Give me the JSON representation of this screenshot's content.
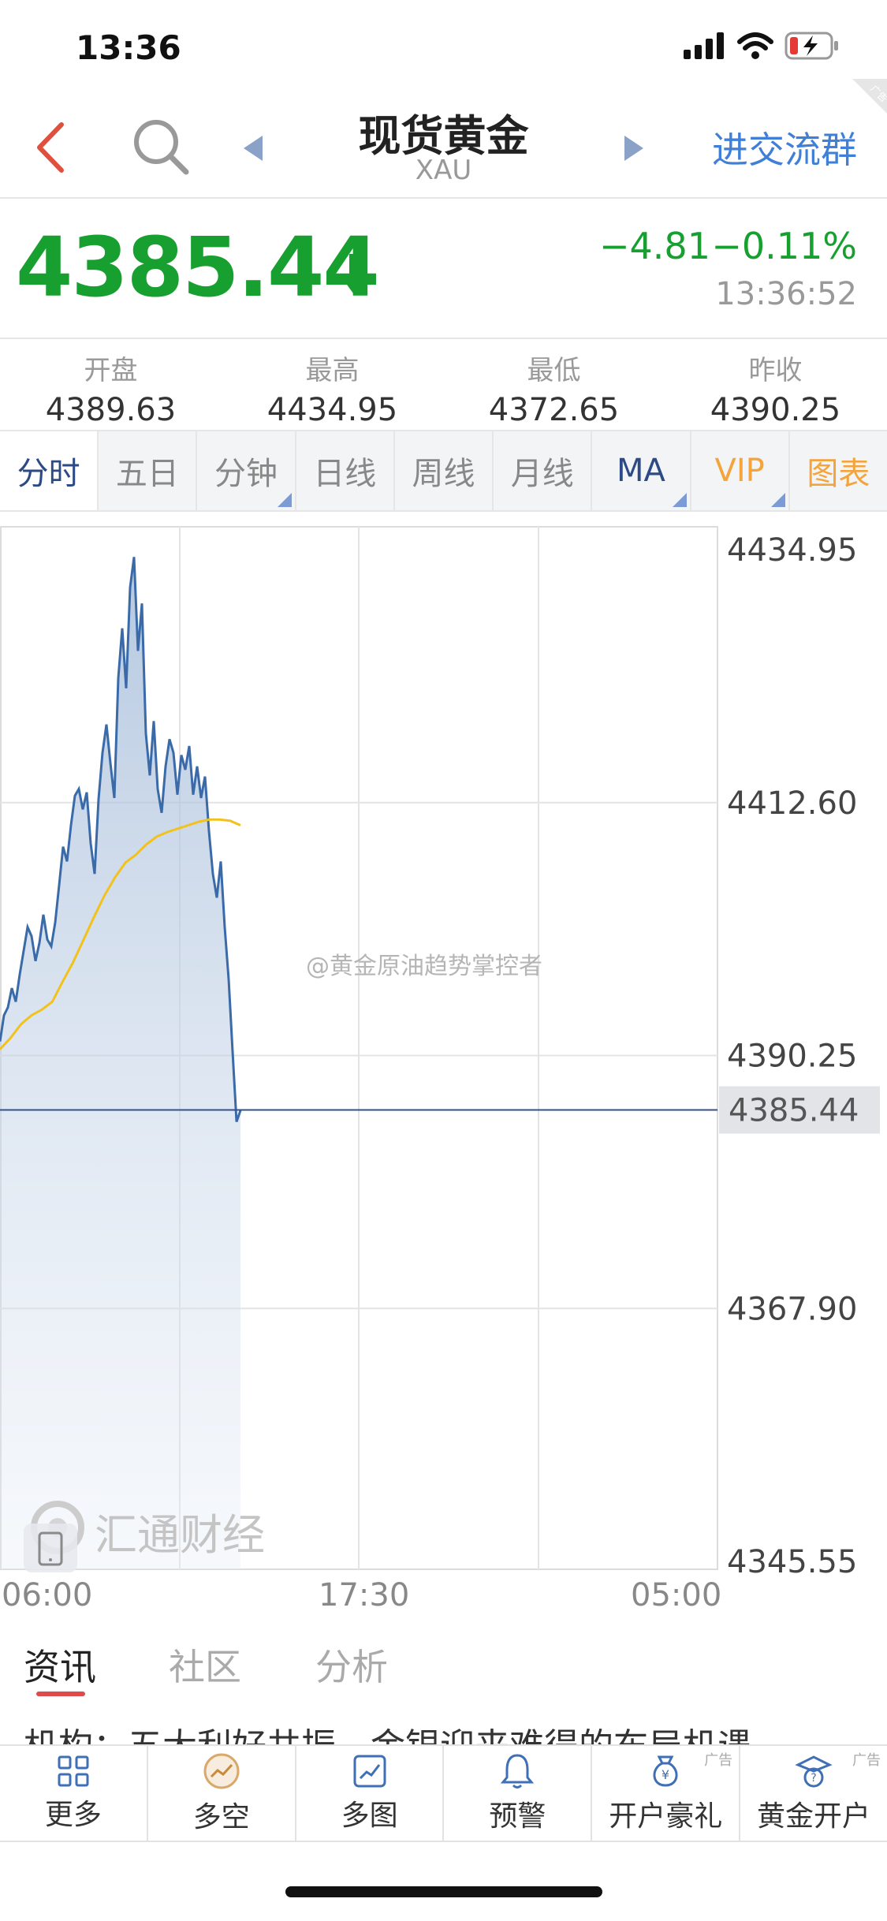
{
  "status": {
    "time": "13:36"
  },
  "header": {
    "title": "现货黄金",
    "subtitle": "XAU",
    "group_link": "进交流群",
    "ad_tag": "广告"
  },
  "quote": {
    "price": "4385.44",
    "change": "−4.81",
    "change_pct": "−0.11%",
    "time": "13:36:52",
    "color_down": "#17a02f"
  },
  "stats": [
    {
      "label": "开盘",
      "value": "4389.63"
    },
    {
      "label": "最高",
      "value": "4434.95"
    },
    {
      "label": "最低",
      "value": "4372.65"
    },
    {
      "label": "昨收",
      "value": "4390.25"
    }
  ],
  "tabs": [
    "分时",
    "五日",
    "分钟",
    "日线",
    "周线",
    "月线",
    "MA",
    "VIP",
    "图表"
  ],
  "chart_data": {
    "type": "area",
    "y_ticks": [
      "4434.95",
      "4412.60",
      "4390.25",
      "4367.90",
      "4345.55"
    ],
    "ylim": [
      4345.55,
      4434.95
    ],
    "x_ticks": [
      "06:00",
      "17:30",
      "05:00"
    ],
    "current_price_label": "4385.44",
    "current_price": 4385.44,
    "reference_price": 4390.25,
    "series": [
      {
        "values": [
          4391.5,
          4393.8,
          4394.5,
          4396.2,
          4395.0,
          4397.4,
          4399.5,
          4401.6,
          4400.8,
          4398.6,
          4400.2,
          4402.7,
          4400.5,
          4399.9,
          4402.0,
          4405.3,
          4408.7,
          4407.4,
          4410.6,
          4413.2,
          4413.8,
          4412.0,
          4413.5,
          4409.0,
          4406.3,
          4412.9,
          4417.0,
          4419.5,
          4416.1,
          4413.0,
          4423.6,
          4428.0,
          4422.7,
          4431.6,
          4434.3,
          4426.0,
          4430.2,
          4418.7,
          4415.0,
          4419.8,
          4413.8,
          4411.7,
          4415.8,
          4418.2,
          4417.0,
          4413.3,
          4416.8,
          4415.5,
          4417.6,
          4413.3,
          4415.8,
          4413.0,
          4414.9,
          4410.1,
          4406.3,
          4404.2,
          4407.4,
          4401.6,
          4397.0,
          4390.6,
          4384.4,
          4385.4
        ]
      },
      {
        "values": [
          4390.8,
          4391.8,
          4393.0,
          4393.8,
          4394.3,
          4395.0,
          4396.8,
          4398.5,
          4400.5,
          4402.5,
          4404.4,
          4406.0,
          4407.3,
          4408.0,
          4408.9,
          4409.6,
          4410.0,
          4410.3,
          4410.6,
          4410.9,
          4411.1,
          4411.1,
          4411.0,
          4410.6
        ]
      }
    ],
    "colors": {
      "price_line": "#3a6aa8",
      "average_line": "#f2c21b"
    }
  },
  "watermarks": {
    "weibo": "@黄金原油趋势掌控者",
    "brand": "汇通财经"
  },
  "subtabs": [
    "资讯",
    "社区",
    "分析"
  ],
  "news_headline": "机构：五大利好共振，金银迎来难得的布局机遇",
  "bottom_bar": [
    {
      "label": "更多",
      "icon": "grid-icon",
      "ad": ""
    },
    {
      "label": "多空",
      "icon": "trend-circle-icon",
      "ad": ""
    },
    {
      "label": "多图",
      "icon": "multi-chart-icon",
      "ad": ""
    },
    {
      "label": "预警",
      "icon": "bell-icon",
      "ad": ""
    },
    {
      "label": "开户豪礼",
      "icon": "money-bag-icon",
      "ad": "广告"
    },
    {
      "label": "黄金开户",
      "icon": "gold-account-icon",
      "ad": "广告"
    }
  ]
}
